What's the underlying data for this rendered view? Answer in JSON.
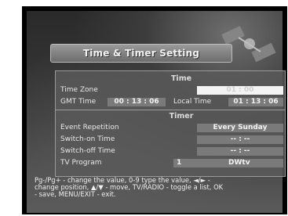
{
  "window": {
    "title": "Time & Timer Setting"
  },
  "sections": {
    "time": "Time",
    "timer": "Timer"
  },
  "time_rows": {
    "time_zone": {
      "label": "Time Zone",
      "value": "01 : 00"
    },
    "gmt_time": {
      "label": "GMT Time",
      "value": "00 : 13 : 06"
    },
    "local_time": {
      "label": "Local Time",
      "value": "01 : 13 : 06"
    }
  },
  "timer_rows": {
    "event_repetition": {
      "label": "Event Repetition",
      "value": "Every Sunday"
    },
    "switch_on": {
      "label": "Switch-on Time",
      "value": "-- : --"
    },
    "switch_off": {
      "label": "Switch-off Time",
      "value": "-- : --"
    },
    "tv_program": {
      "label": "TV Program",
      "number": "1",
      "name": "DWtv"
    }
  },
  "help_text": "Pg-/Pg+ - change the value, 0-9 type the value, ◄/► -\nchange position, ▲/▼ - move, TV/RADIO - toggle a list, OK\n- save, MENU/EXIT - exit.",
  "colors": {
    "selected_field": "#f3f3f3",
    "field": "#7a7a7a",
    "panel": "#5a5a5a"
  }
}
